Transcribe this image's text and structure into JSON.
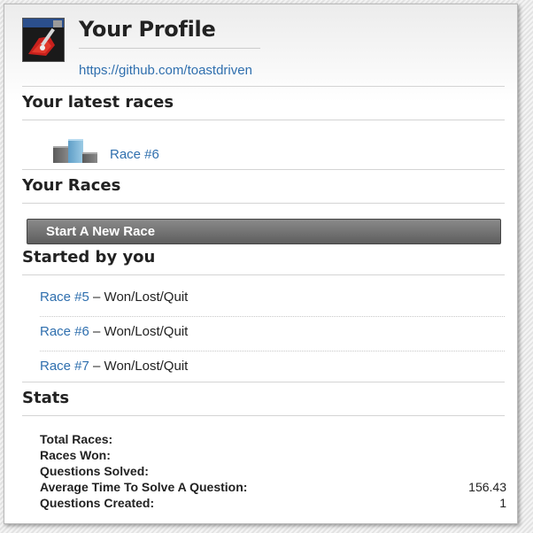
{
  "profile": {
    "title": "Your Profile",
    "github_url": "https://github.com/toastdriven"
  },
  "latest_races": {
    "heading": "Your latest races",
    "items": [
      {
        "label": "Race #6",
        "icon": "podium-icon"
      }
    ]
  },
  "your_races": {
    "heading": "Your Races",
    "start_button": "Start A New Race"
  },
  "started_by_you": {
    "heading": "Started by you",
    "races": [
      {
        "label": "Race #5",
        "status": " – Won/Lost/Quit"
      },
      {
        "label": "Race #6",
        "status": " – Won/Lost/Quit"
      },
      {
        "label": "Race #7",
        "status": " – Won/Lost/Quit"
      }
    ]
  },
  "stats": {
    "heading": "Stats",
    "rows": [
      {
        "label": "Total Races:",
        "value": ""
      },
      {
        "label": "Races Won:",
        "value": ""
      },
      {
        "label": "Questions Solved:",
        "value": ""
      },
      {
        "label": "Average Time To Solve A Question:",
        "value": "156.43"
      },
      {
        "label": "Questions Created:",
        "value": "1"
      }
    ]
  },
  "colors": {
    "link": "#2f6fae",
    "podium_winner": "#7ab3d6",
    "podium_other": "#6b6b6b",
    "button": "#6e6e6e"
  }
}
